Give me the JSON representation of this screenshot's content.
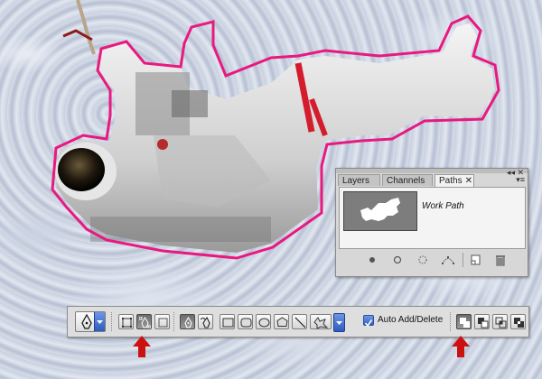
{
  "colors": {
    "selection_outline": "#e8197f",
    "highlight_arrow": "#cc1111",
    "checkbox_blue": "#2f5fc4",
    "toolbar_bg": "#dedede",
    "panel_bg": "#d7d7d7",
    "thumbnail_bg": "#7d7d7d"
  },
  "paths_panel": {
    "tabs": [
      {
        "label": "Layers",
        "active": false
      },
      {
        "label": "Channels",
        "active": false
      },
      {
        "label": "Paths",
        "active": true,
        "close_glyph": "✕"
      }
    ],
    "window_controls": "◂◂ ✕",
    "menu_glyph": "▾≡",
    "paths": [
      {
        "name": "Work Path",
        "selected": false
      }
    ],
    "bottom_buttons": [
      "fill-path-icon",
      "stroke-path-icon",
      "load-selection-icon",
      "make-work-path-icon",
      "new-path-icon",
      "trash-icon"
    ]
  },
  "options_bar": {
    "tool_preset": "pen-tool-icon",
    "path_mode_buttons": [
      {
        "icon": "shape-layers-icon",
        "pressed": false
      },
      {
        "icon": "paths-icon",
        "pressed": true,
        "highlighted": true
      },
      {
        "icon": "fill-pixels-icon",
        "pressed": false
      }
    ],
    "tool_buttons": [
      {
        "icon": "pen-tool-icon",
        "pressed": true
      },
      {
        "icon": "freeform-pen-icon",
        "pressed": false
      },
      {
        "icon": "rectangle-icon",
        "pressed": false
      },
      {
        "icon": "rounded-rectangle-icon",
        "pressed": false
      },
      {
        "icon": "ellipse-icon",
        "pressed": false
      },
      {
        "icon": "polygon-icon",
        "pressed": false
      },
      {
        "icon": "line-icon",
        "pressed": false
      },
      {
        "icon": "custom-shape-icon",
        "pressed": false
      }
    ],
    "auto_add_delete": {
      "label": "Auto Add/Delete",
      "checked": true
    },
    "combine_modes": [
      {
        "icon": "add-to-area-icon",
        "pressed": true,
        "highlighted": true
      },
      {
        "icon": "subtract-icon",
        "pressed": false
      },
      {
        "icon": "intersect-icon",
        "pressed": false
      },
      {
        "icon": "exclude-overlap-icon",
        "pressed": false
      }
    ]
  }
}
